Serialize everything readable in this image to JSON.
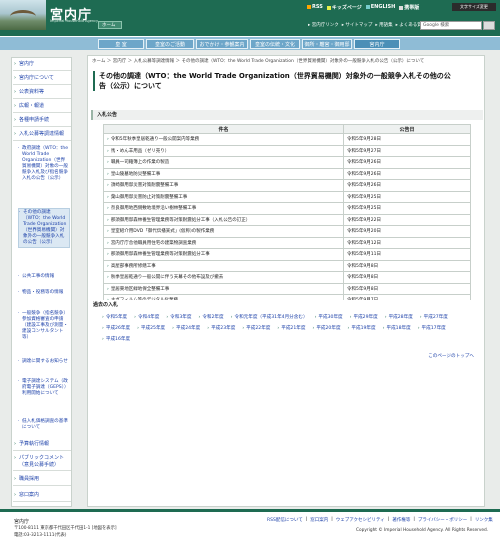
{
  "header": {
    "title": "宮内庁",
    "subtitle": "Imperial Household Agency",
    "home": "ホーム",
    "top_links": [
      "RSS",
      "キッズページ",
      "ENGLISH",
      "携帯版"
    ],
    "lang_button": "文字サイズ変更",
    "sub_links": [
      "▸ 宮内庁リンク",
      "▸ サイトマップ",
      "▸ 用語集",
      "▸ よくある質問"
    ],
    "search_placeholder": "Google 検索"
  },
  "nav": {
    "tabs": [
      "皇  室",
      "皇室のご活動",
      "おでかけ・参観案内",
      "皇室の伝統・文化",
      "御所・離宮・御用邸",
      "宮内庁"
    ]
  },
  "sidebar": {
    "items": [
      "宮内庁",
      "宮内庁について",
      "公表資料等",
      "広報・報道",
      "各種申請手続",
      "入札公募等調達情報",
      "政府調達（WTO：the World Trade Organization（世界貿易機関）対象の一般競争入札及び指名競争入札の公告（公示）",
      "その他の調達（WTO：the World Trade Organization（世界貿易機関）対象外の一般競争入札の公告（公示）",
      "公共工事の情報",
      "物品・役務等の情報",
      "一般競争（指名競争）参加資格審査の申請（建設工事及び測量・建設コンサルタント等）",
      "調達に関するお知らせ",
      "電子調達システム（政府電子調達（GEPS））利用開始について",
      "低入札価格調査の基準について",
      "予算執行情報",
      "パブリックコメント（意見公募手続）",
      "職員採用",
      "窓口案内"
    ]
  },
  "main": {
    "breadcrumb": "ホーム ＞ 宮内庁 ＞ 入札公募等調達情報 ＞ その他の調達（WTO：the World Trade Organization（世界貿易機関）対象外の一般競争入札の公告（公示）について",
    "title": "その他の調達（WTO：the World Trade Organization（世界貿易機関）対象外の一般競争入札その他の公告（公示）について",
    "section_bid": "入札公告",
    "col_name": "件名",
    "col_date": "公告日",
    "rows": [
      {
        "name": "令和5年秋季皇居乾通り一般公開案内等業務",
        "date": "令和5年9月28日"
      },
      {
        "name": "馬・めん羊用品（ゼリ売り）",
        "date": "令和5年9月27日"
      },
      {
        "name": "職員一司籍簿上の作業の製造",
        "date": "令和5年9月26日"
      },
      {
        "name": "皇山陵墓地防災整備工事",
        "date": "令和5年9月26日"
      },
      {
        "name": "須崎御用邸災害対策耐震整備工事",
        "date": "令和5年9月26日"
      },
      {
        "name": "葉山御用邸災害防止対策耐震整備工事",
        "date": "令和5年9月25日"
      },
      {
        "name": "奈良御用地西側敷地境界沿い樹林整備工事",
        "date": "令和5年9月25日"
      },
      {
        "name": "那須御用邸森林養生管理業務等対策耐震処分工事（入札公告の訂正）",
        "date": "令和5年9月22日"
      },
      {
        "name": "皇室紹介用DVD「御代伝播某式」(仮称)の製作業務",
        "date": "令和5年9月20日"
      },
      {
        "name": "宮内庁庁舎他職員用住宅の建築物調査業務",
        "date": "令和5年9月12日"
      },
      {
        "name": "那須御用邸森林養生管理業務等対策耐震処分工事",
        "date": "令和5年9月11日"
      },
      {
        "name": "高屋部事務所修繕工事",
        "date": "令和5年9月8日"
      },
      {
        "name": "秋季皇居乾通り一般公開に伴う天幕その他布設及び撤去",
        "date": "令和5年9月8日"
      },
      {
        "name": "皇居東地区緑地保全整備工事",
        "date": "令和5年9月8日"
      },
      {
        "name": "ネガフィルム等のデジタル化業務",
        "date": "令和5年9月7日"
      }
    ],
    "section_past": "過去の入札",
    "past_years": [
      "令和5年度",
      "令和4年度",
      "令和3年度",
      "令和2年度",
      "令和元年度（平成31年4月分含む）",
      "平成30年度",
      "平成29年度",
      "平成28年度",
      "平成27年度",
      "平成26年度",
      "平成25年度",
      "平成24年度",
      "平成23年度",
      "平成22年度",
      "平成21年度",
      "平成20年度",
      "平成19年度",
      "平成18年度",
      "平成17年度",
      "平成16年度"
    ],
    "to_top": "このページのトップへ"
  },
  "footer": {
    "org": "宮内庁",
    "address": "〒100-8111 東京都千代田区千代田1-1 [地図を表示]",
    "tel": "電話:03-3213-1111(代表)",
    "links": [
      "RSS配信について",
      "窓口案内",
      "ウェブアクセシビリティ",
      "著作権等",
      "プライバシー・ポリシー",
      "リンク集"
    ],
    "copyright": "Copyright © Imperial Household Agency. All Rights Reserved."
  }
}
